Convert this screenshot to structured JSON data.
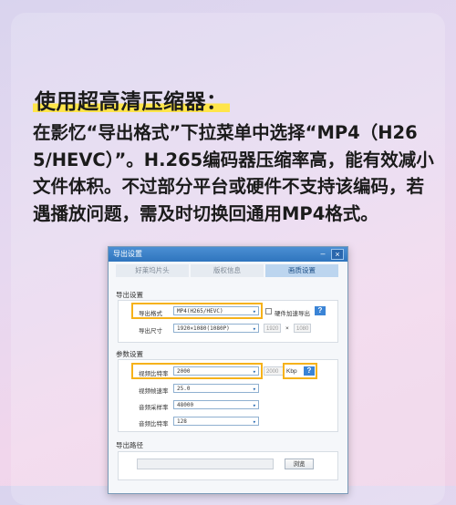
{
  "heading": "使用超高清压缩器：",
  "paragraph": "在影忆“导出格式”下拉菜单中选择“MP4（H265/HEVC）”。H.265编码器压缩率高，能有效减小文件体积。不过部分平台或硬件不支持该编码，若遇播放问题，需及时切换回通用MP4格式。",
  "dialog": {
    "title": "导出设置",
    "minimize_label": "–",
    "close_label": "×",
    "steps": [
      "好莱坞片头",
      "版权信息",
      "画质设置"
    ],
    "export_section": {
      "label": "导出设置",
      "format_label": "导出格式",
      "format_value": "MP4(H265/HEVC)",
      "hw_accel_label": "硬件加速导出",
      "size_label": "导出尺寸",
      "size_value": "1920×1080(1080P)",
      "width": "1920",
      "times": "×",
      "height": "1080"
    },
    "param_section": {
      "label": "参数设置",
      "bitrate_label": "视频比特率",
      "bitrate_value": "2000",
      "bitrate_num": "2000",
      "bitrate_unit": "Kbp",
      "fps_label": "视频帧速率",
      "fps_value": "25.0",
      "audio_rate_label": "音频采样率",
      "audio_rate_value": "48000",
      "audio_bitrate_label": "音频比特率",
      "audio_bitrate_value": "128"
    },
    "path_section": {
      "label": "导出路径",
      "browse_label": "浏览"
    },
    "help_label": "?"
  },
  "colors": {
    "highlight": "#f6b21a",
    "accent": "#3a84d6",
    "title_underline": "#ffe54a"
  }
}
